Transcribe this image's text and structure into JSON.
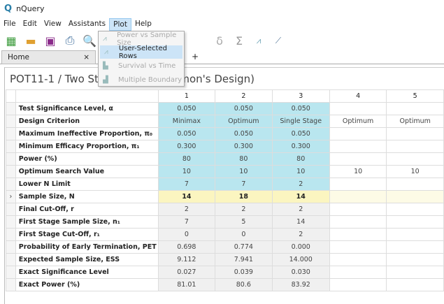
{
  "app": {
    "title": "nQuery"
  },
  "menu": [
    "File",
    "Edit",
    "View",
    "Assistants",
    "Plot",
    "Help"
  ],
  "plot_menu": [
    {
      "label": "Power vs Sample Size",
      "enabled": false,
      "icon": "line-chart-icon"
    },
    {
      "label": "User-Selected Rows",
      "enabled": true,
      "icon": "line-chart-icon"
    },
    {
      "label": "Survival vs Time",
      "enabled": false,
      "icon": "survival-chart-icon"
    },
    {
      "label": "Multiple Boundary",
      "enabled": false,
      "icon": "boundary-chart-icon"
    }
  ],
  "toolbar": {
    "delta": "δ",
    "sigma": "Σ"
  },
  "tabs": [
    {
      "label": "Home",
      "close": "×"
    }
  ],
  "add_tab": "+",
  "doc_title": "POT11-1 / Two Stage Phase II (Simon's Design)",
  "columns": [
    "1",
    "2",
    "3",
    "4",
    "5"
  ],
  "rows": [
    {
      "label": "Test Significance Level, α",
      "values": [
        "0.050",
        "0.050",
        "0.050",
        "",
        ""
      ],
      "style": "input"
    },
    {
      "label": "Design Criterion",
      "values": [
        "Minimax",
        "Optimum",
        "Single Stage",
        "Optimum",
        "Optimum"
      ],
      "style": "input"
    },
    {
      "label": "Maximum Ineffective Proportion, π₀",
      "values": [
        "0.050",
        "0.050",
        "0.050",
        "",
        ""
      ],
      "style": "input"
    },
    {
      "label": "Minimum Efficacy Proportion, π₁",
      "values": [
        "0.300",
        "0.300",
        "0.300",
        "",
        ""
      ],
      "style": "input"
    },
    {
      "label": "Power (%)",
      "values": [
        "80",
        "80",
        "80",
        "",
        ""
      ],
      "style": "input"
    },
    {
      "label": "Optimum Search Value",
      "values": [
        "10",
        "10",
        "10",
        "10",
        "10"
      ],
      "style": "input"
    },
    {
      "label": "Lower N Limit",
      "values": [
        "7",
        "7",
        "2",
        "",
        ""
      ],
      "style": "input"
    },
    {
      "label": "Sample Size, N",
      "values": [
        "14",
        "18",
        "14",
        "",
        ""
      ],
      "style": "solve",
      "marker": "›"
    },
    {
      "label": "Final Cut-Off, r",
      "values": [
        "2",
        "2",
        "2",
        "",
        ""
      ],
      "style": "output"
    },
    {
      "label": "First Stage Sample Size, n₁",
      "values": [
        "7",
        "5",
        "14",
        "",
        ""
      ],
      "style": "output"
    },
    {
      "label": "First Stage Cut-Off, r₁",
      "values": [
        "0",
        "0",
        "2",
        "",
        ""
      ],
      "style": "output"
    },
    {
      "label": "Probability of Early Termination, PET",
      "values": [
        "0.698",
        "0.774",
        "0.000",
        "",
        ""
      ],
      "style": "output"
    },
    {
      "label": "Expected Sample Size, ESS",
      "values": [
        "9.112",
        "7.941",
        "14.000",
        "",
        ""
      ],
      "style": "output"
    },
    {
      "label": "Exact Significance Level",
      "values": [
        "0.027",
        "0.039",
        "0.030",
        "",
        ""
      ],
      "style": "output"
    },
    {
      "label": "Exact Power (%)",
      "values": [
        "81.01",
        "80.6",
        "83.92",
        "",
        ""
      ],
      "style": "output"
    }
  ],
  "colors": {
    "input": "#b9e6ef",
    "solve": "#fbf5c0",
    "output": "#f0f0f0",
    "menu_highlight": "#cce4f7"
  }
}
